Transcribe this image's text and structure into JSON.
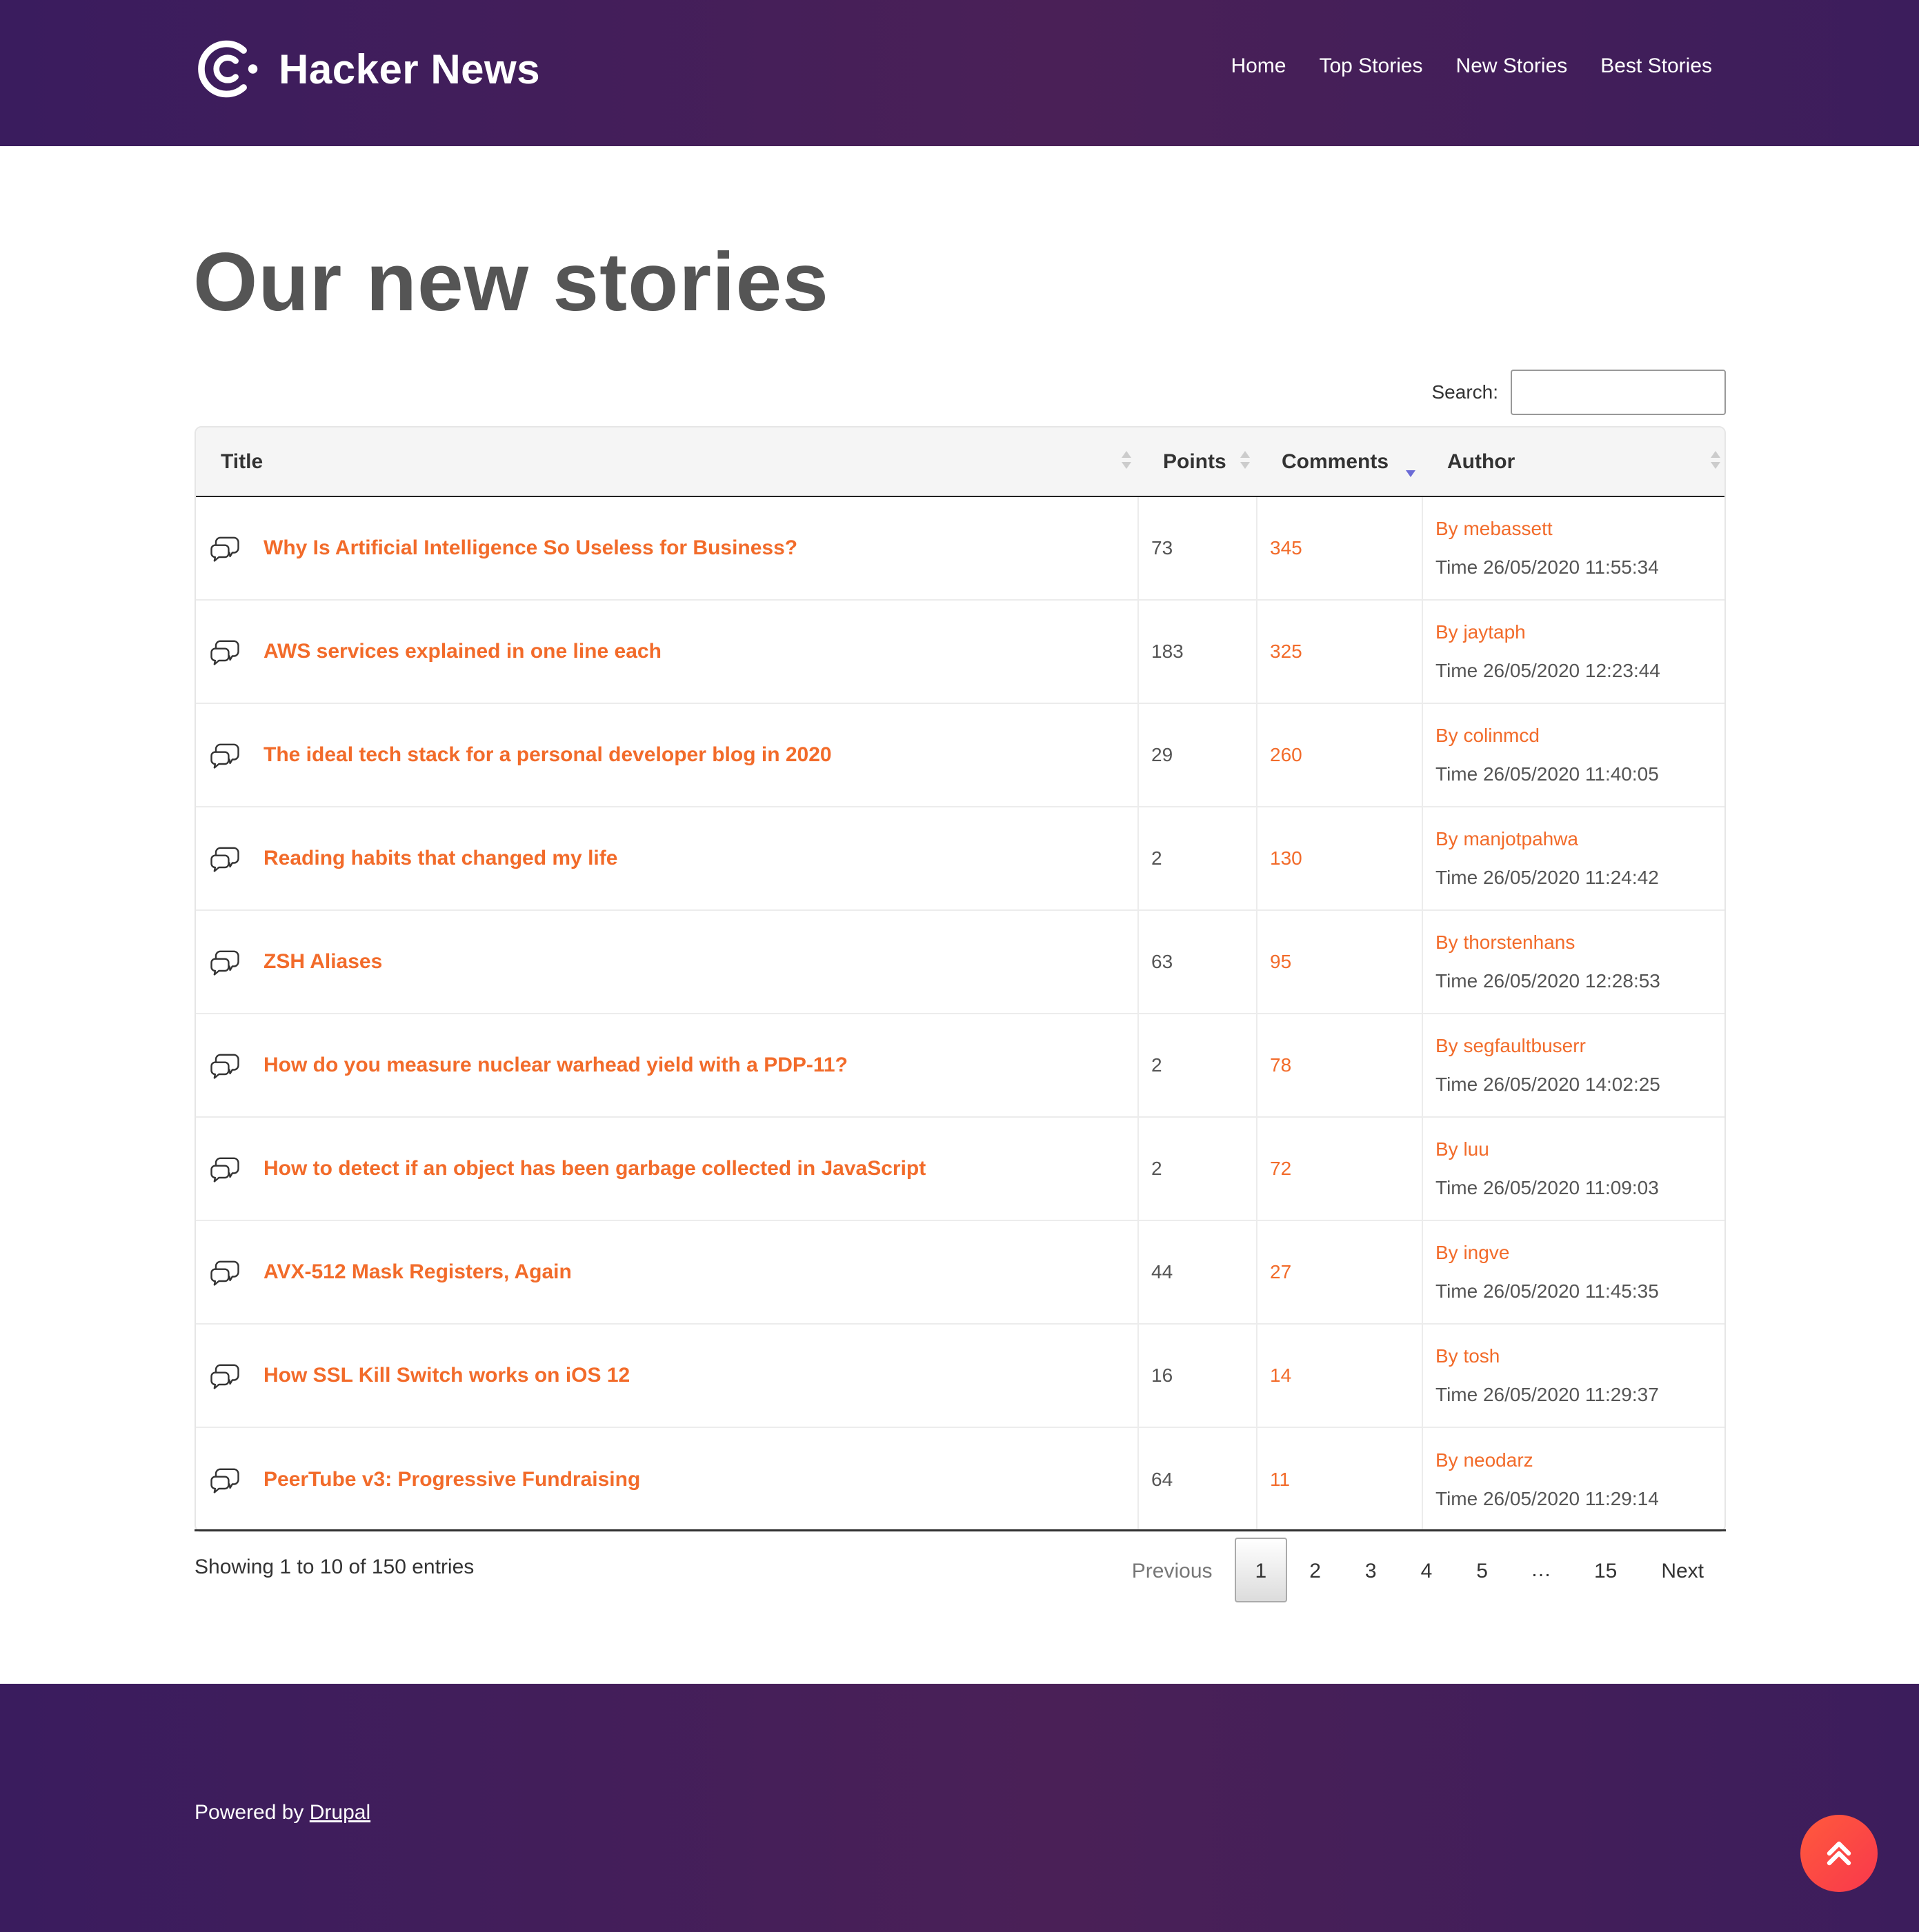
{
  "header": {
    "site_name": "Hacker News",
    "nav": [
      {
        "label": "Home"
      },
      {
        "label": "Top Stories"
      },
      {
        "label": "New Stories"
      },
      {
        "label": "Best Stories"
      }
    ]
  },
  "page": {
    "title": "Our new stories"
  },
  "search": {
    "label": "Search:",
    "value": "",
    "placeholder": ""
  },
  "table": {
    "columns": {
      "title": "Title",
      "points": "Points",
      "comments": "Comments",
      "author": "Author"
    },
    "sorted_column": "Comments",
    "sort_direction": "descending",
    "rows": [
      {
        "title": "Why Is Artificial Intelligence So Useless for Business?",
        "points": "73",
        "comments": "345",
        "author": "By mebassett",
        "time": "Time 26/05/2020 11:55:34"
      },
      {
        "title": "AWS services explained in one line each",
        "points": "183",
        "comments": "325",
        "author": "By jaytaph",
        "time": "Time 26/05/2020 12:23:44"
      },
      {
        "title": "The ideal tech stack for a personal developer blog in 2020",
        "points": "29",
        "comments": "260",
        "author": "By colinmcd",
        "time": "Time 26/05/2020 11:40:05"
      },
      {
        "title": "Reading habits that changed my life",
        "points": "2",
        "comments": "130",
        "author": "By manjotpahwa",
        "time": "Time 26/05/2020 11:24:42"
      },
      {
        "title": "ZSH Aliases",
        "points": "63",
        "comments": "95",
        "author": "By thorstenhans",
        "time": "Time 26/05/2020 12:28:53"
      },
      {
        "title": "How do you measure nuclear warhead yield with a PDP-11?",
        "points": "2",
        "comments": "78",
        "author": "By segfaultbuserr",
        "time": "Time 26/05/2020 14:02:25"
      },
      {
        "title": "How to detect if an object has been garbage collected in JavaScript",
        "points": "2",
        "comments": "72",
        "author": "By luu",
        "time": "Time 26/05/2020 11:09:03"
      },
      {
        "title": "AVX-512 Mask Registers, Again",
        "points": "44",
        "comments": "27",
        "author": "By ingve",
        "time": "Time 26/05/2020 11:45:35"
      },
      {
        "title": "How SSL Kill Switch works on iOS 12",
        "points": "16",
        "comments": "14",
        "author": "By tosh",
        "time": "Time 26/05/2020 11:29:37"
      },
      {
        "title": "PeerTube v3: Progressive Fundraising",
        "points": "64",
        "comments": "11",
        "author": "By neodarz",
        "time": "Time 26/05/2020 11:29:14"
      }
    ]
  },
  "info": {
    "text": "Showing 1 to 10 of 150 entries"
  },
  "pagination": {
    "previous": "Previous",
    "pages": [
      "1",
      "2",
      "3",
      "4",
      "5"
    ],
    "ellipsis": "…",
    "last": "15",
    "next": "Next",
    "current": "1"
  },
  "footer": {
    "powered_prefix": "Powered by ",
    "powered_link": "Drupal"
  },
  "icons": {
    "logo": "hacker-news-logo-icon",
    "row_icon": "chat-bubbles-icon",
    "back_to_top": "double-chevron-up-icon"
  },
  "colors": {
    "header_bg": "#3a1c5e",
    "accent": "#f26b2a",
    "back_to_top": "#f8384c",
    "sort_active": "#6b6bd6"
  }
}
